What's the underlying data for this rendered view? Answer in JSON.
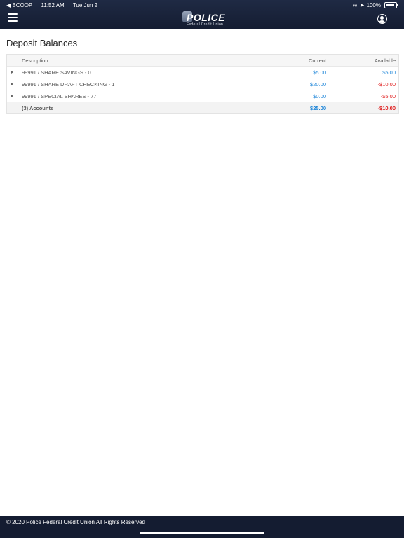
{
  "status_bar": {
    "carrier": "◀ BCOOP",
    "time": "11:52 AM",
    "date": "Tue Jun 2",
    "battery": "100%"
  },
  "header": {
    "logo_text": "POLICE",
    "logo_subtext": "Federal Credit Union",
    "menu_icon": "hamburger-icon",
    "user_icon": "user-icon"
  },
  "page": {
    "title": "Deposit Balances"
  },
  "table": {
    "columns": {
      "description": "Description",
      "current": "Current",
      "available": "Available"
    },
    "rows": [
      {
        "description": "99991 / SHARE SAVINGS - 0",
        "current": "$5.00",
        "available": "$5.00"
      },
      {
        "description": "99991 / SHARE DRAFT CHECKING - 1",
        "current": "$20.00",
        "available": "-$10.00"
      },
      {
        "description": "99991 / SPECIAL SHARES - 77",
        "current": "$0.00",
        "available": "-$5.00"
      }
    ],
    "total": {
      "label": "(3) Accounts",
      "current": "$25.00",
      "available": "-$10.00"
    }
  },
  "footer": {
    "copyright": "© 2020 Police Federal Credit Union All Rights Reserved"
  },
  "colors": {
    "header_bg": "#1f2a44",
    "positive": "#1b84d8",
    "negative": "#e02020"
  }
}
